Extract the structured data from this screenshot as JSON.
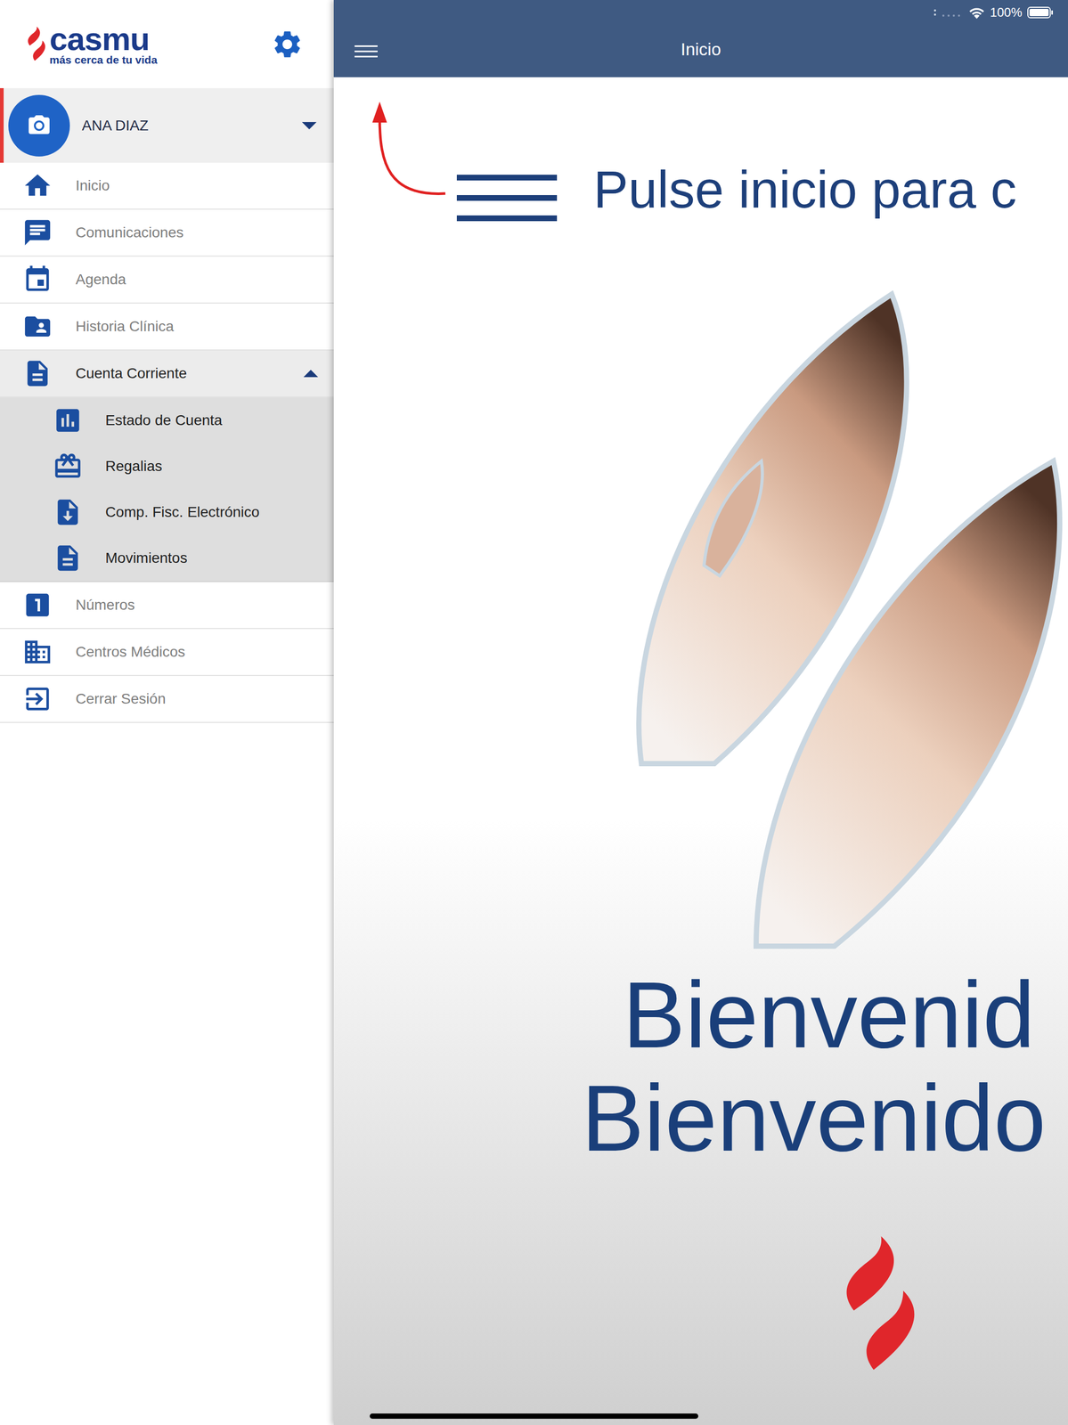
{
  "status_bar": {
    "battery": "100%"
  },
  "sidebar": {
    "logo": {
      "name": "casmu",
      "tagline": "más cerca de tu vida"
    },
    "user": {
      "name": "ANA DIAZ",
      "expanded": false
    },
    "items": [
      {
        "label": "Inicio",
        "expanded": false,
        "children": []
      },
      {
        "label": "Comunicaciones",
        "expanded": false,
        "children": []
      },
      {
        "label": "Agenda",
        "expanded": false,
        "children": []
      },
      {
        "label": "Historia Clínica",
        "expanded": false,
        "children": []
      },
      {
        "label": "Cuenta Corriente",
        "expanded": true,
        "children": [
          {
            "label": "Estado de Cuenta"
          },
          {
            "label": "Regalias"
          },
          {
            "label": "Comp. Fisc. Electrónico"
          },
          {
            "label": "Movimientos"
          }
        ]
      },
      {
        "label": "Números",
        "expanded": false,
        "children": []
      },
      {
        "label": "Centros Médicos",
        "expanded": false,
        "children": []
      },
      {
        "label": "Cerrar Sesión",
        "expanded": false,
        "children": []
      }
    ]
  },
  "header": {
    "title": "Inicio"
  },
  "welcome": {
    "hint": "Pulse inicio para c",
    "greetings": [
      "Bienvenid",
      "Bienvenido"
    ]
  }
}
